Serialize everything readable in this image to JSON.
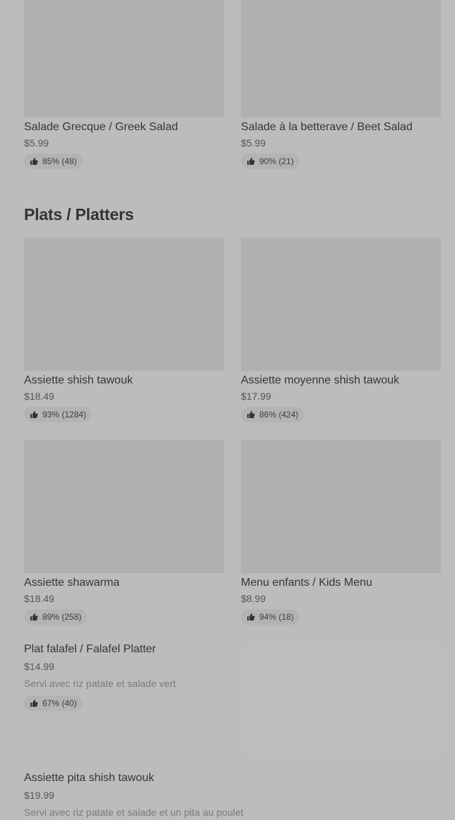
{
  "salads": [
    {
      "name": "Salade Grecque / Greek Salad",
      "price": "$5.99",
      "rating": "85% (48)"
    },
    {
      "name": "Salade à la betterave / Beet Salad",
      "price": "$5.99",
      "rating": "90% (21)"
    }
  ],
  "platters_section": {
    "title": "Plats / Platters"
  },
  "platters": [
    {
      "name": "Assiette shish tawouk",
      "price": "$18.49",
      "rating": "93% (1284)"
    },
    {
      "name": "Assiette moyenne shish tawouk",
      "price": "$17.99",
      "rating": "86% (424)"
    },
    {
      "name": "Assiette shawarma",
      "price": "$18.49",
      "rating": "89% (258)"
    },
    {
      "name": "Menu enfants / Kids Menu",
      "price": "$8.99",
      "rating": "94% (18)"
    }
  ],
  "list_items": [
    {
      "name": "Plat falafel / Falafel Platter",
      "price": "$14.99",
      "description": "Servi avec riz patate et salade vert",
      "rating": "67% (40)"
    },
    {
      "name": "Assiette pita shish tawouk",
      "price": "$19.99",
      "description": "Servi avec riz patate et salade et un pita au poulet"
    }
  ],
  "icons": {
    "rating": "thumbs-up-icon"
  }
}
